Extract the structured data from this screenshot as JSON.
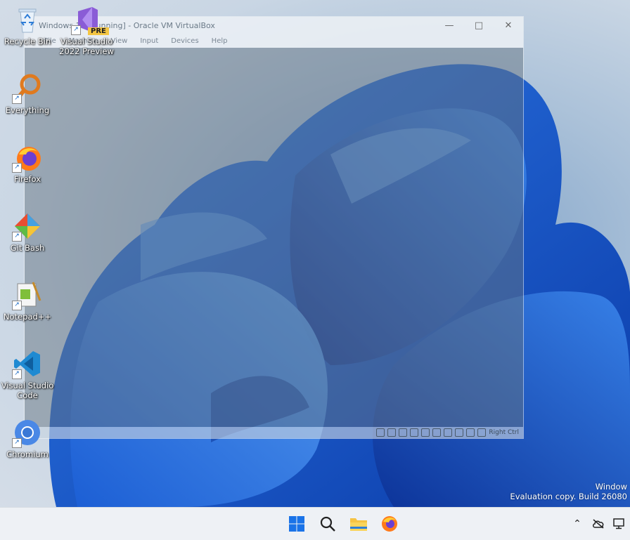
{
  "desktop": {
    "icons": [
      {
        "label": "Recycle Bin",
        "icon": "recycle-bin-icon"
      },
      {
        "label": "Visual Studio 2022 Preview",
        "icon": "visual-studio-icon",
        "badge": "PRE"
      },
      {
        "label": "Everything",
        "icon": "everything-search-icon"
      },
      {
        "label": "Firefox",
        "icon": "firefox-icon"
      },
      {
        "label": "Git Bash",
        "icon": "git-bash-icon"
      },
      {
        "label": "Notepad++",
        "icon": "notepad-plus-plus-icon"
      },
      {
        "label": "Visual Studio Code",
        "icon": "vscode-icon"
      },
      {
        "label": "Chromium",
        "icon": "chromium-icon"
      }
    ]
  },
  "vbox": {
    "title": "Windows 11 [Running] - Oracle VM VirtualBox",
    "menu": [
      "File",
      "Machine",
      "View",
      "Input",
      "Devices",
      "Help"
    ],
    "host_key": "Right Ctrl"
  },
  "watermark": {
    "line1": "Window",
    "line2": "Evaluation copy. Build 26080"
  },
  "taskbar": {
    "apps": [
      "start-icon",
      "search-icon",
      "file-explorer-icon",
      "firefox-icon"
    ],
    "tray": [
      "chevron-up-icon",
      "cloud-icon",
      "display-icon"
    ]
  },
  "colors": {
    "accent": "#0a5ccc",
    "taskbar_bg": "#eef1f5"
  }
}
